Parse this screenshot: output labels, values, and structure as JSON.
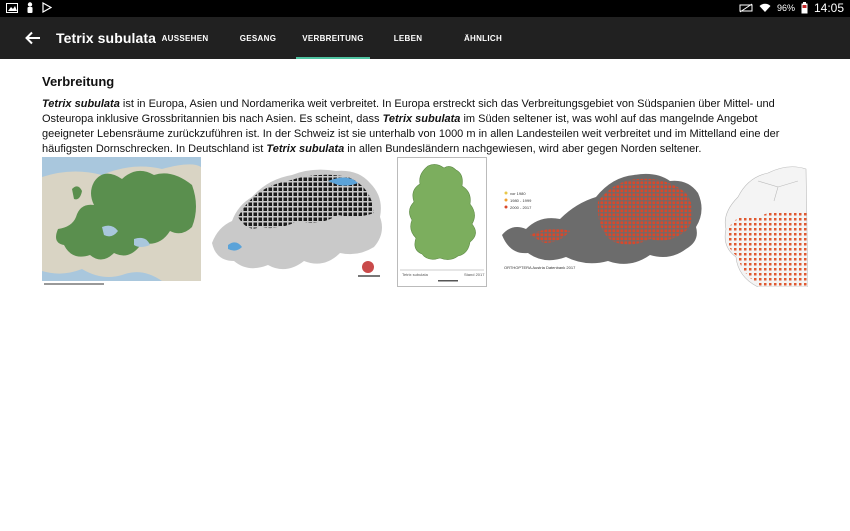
{
  "statusbar": {
    "battery": "96%",
    "time": "14:05"
  },
  "appbar": {
    "title": "Tetrix subulata"
  },
  "tabs": [
    {
      "label": "AUSSEHEN"
    },
    {
      "label": "GESANG"
    },
    {
      "label": "VERBREITUNG",
      "active": true
    },
    {
      "label": "LEBEN"
    },
    {
      "label": "ÄHNLICH"
    }
  ],
  "section": {
    "heading": "Verbreitung",
    "p_sp1": "Tetrix subulata",
    "p_t1": " ist in Europa, Asien und Nordamerika weit verbreitet. In Europa erstreckt sich das Verbreitungsgebiet von Südspanien über Mittel- und Osteuropa inklusive Grossbritannien bis nach Asien. Es scheint, dass ",
    "p_sp2": "Tetrix subulata",
    "p_t2": " im Süden seltener ist, was wohl auf das mangelnde Angebot geeigneter Lebensräume zurückzuführen ist. In der Schweiz ist sie unterhalb von 1000 m in allen Landesteilen weit verbreitet und im Mittelland eine der häufigsten Dornschrecken. In Deutschland ist ",
    "p_sp3": "Tetrix subulata",
    "p_t3": " in allen Bundesländern nachgewiesen, wird aber gegen Norden seltener."
  },
  "maps": {
    "austria_legend": [
      "vor 1980",
      "1980 - 1999",
      "2000 - 2017"
    ],
    "austria_credit": "ORTHOPTERA Austria Datenbank 2017",
    "germany_caption": "Stand 2017"
  },
  "colors": {
    "appbar": "#212121",
    "accent": "#4fc3a1",
    "map_green": "#5a8f4e"
  }
}
